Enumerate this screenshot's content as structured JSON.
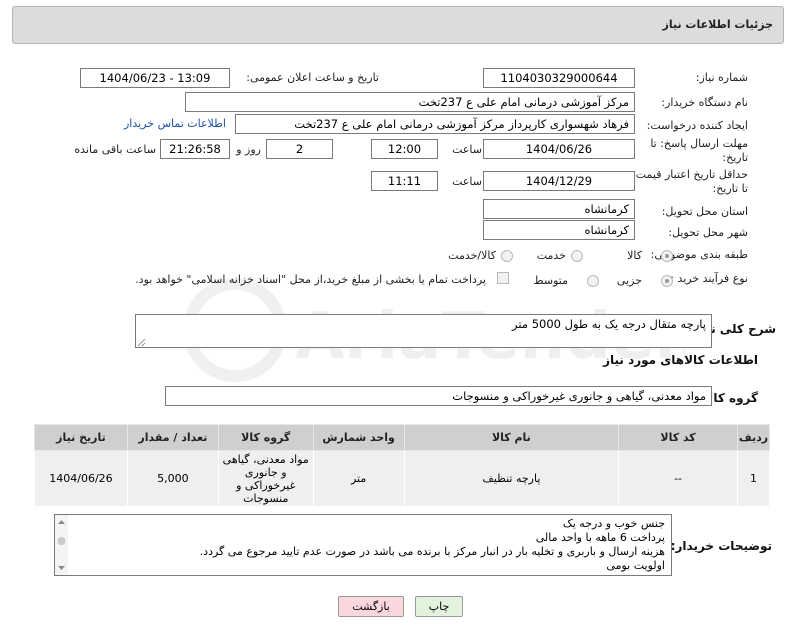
{
  "header": {
    "title": "جزئیات اطلاعات نیاز"
  },
  "form": {
    "need_number": {
      "label": "شماره نیاز:",
      "value": "1104030329000644"
    },
    "announce_datetime": {
      "label": "تاریخ و ساعت اعلان عمومی:",
      "value": "1404/06/23 - 13:09"
    },
    "buyer_org": {
      "label": "نام دستگاه خریدار:",
      "value": "مرکز آموزشی درمانی امام علی ع 237تخت"
    },
    "requester": {
      "label": "ایجاد کننده درخواست:",
      "value": "فرهاد شهسواری کارپرداز  مرکز آموزشی درمانی امام علی ع 237تخت",
      "contact_link": "اطلاعات تماس خریدار"
    },
    "reply_deadline": {
      "label_line1": "مهلت ارسال پاسخ: تا",
      "label_line2": "تاریخ:",
      "date": "1404/06/26",
      "time_label": "ساعت",
      "time": "12:00",
      "days": "2",
      "days_label": "روز و",
      "remaining_time": "21:26:58",
      "remaining_label": "ساعت باقی مانده"
    },
    "price_validity": {
      "label_line1": "حداقل تاریخ اعتبار قیمت:",
      "label_line2": "تا تاریخ:",
      "date": "1404/12/29",
      "time_label": "ساعت",
      "time": "11:11"
    },
    "delivery_province": {
      "label": "استان محل تحویل:",
      "value": "کرمانشاه"
    },
    "delivery_city": {
      "label": "شهر محل تحویل:",
      "value": "کرمانشاه"
    },
    "category": {
      "label": "طبقه بندی موضوعی:",
      "options": [
        "کالا",
        "خدمت",
        "کالا/خدمت"
      ],
      "selected": "کالا"
    },
    "purchase_type": {
      "label": "نوع فرآیند خرید :",
      "options": [
        "جزیی",
        "متوسط"
      ],
      "selected": "جزیی",
      "payment_note": "پرداخت تمام یا بخشی از مبلغ خرید،از محل \"اسناد خزانه اسلامی\" خواهد بود."
    }
  },
  "description": {
    "label": "شرح کلی نیاز:",
    "value": "پارچه متقال درجه یک به طول 5000 متر"
  },
  "goods_section": {
    "title": "اطلاعات کالاهای مورد نیاز",
    "group_label": "گروه کالا:",
    "group_value": "مواد معدنی، گیاهی و جانوری غیرخوراکی و منسوجات"
  },
  "items_table": {
    "headers": [
      "ردیف",
      "کد کالا",
      "نام کالا",
      "واحد شمارش",
      "گروه کالا",
      "تعداد / مقدار",
      "تاریخ نیاز"
    ],
    "rows": [
      {
        "row": "1",
        "code": "--",
        "name": "پارچه تنظیف",
        "unit": "متر",
        "group": "مواد معدنی، گیاهی و جانوری غیرخوراکی و منسوجات",
        "qty": "5,000",
        "date": "1404/06/26"
      }
    ]
  },
  "buyer_notes": {
    "label": "توضیحات خریدار:",
    "lines": [
      "جنس خوب و درجه یک",
      "پرداخت 6 ماهه  با واحد مالی",
      "هزینه ارسال و باربری و تخلیه بار در انبار مرکز با برنده می باشد در صورت عدم تایید مرجوع می گردد.",
      "اولویت بومی"
    ]
  },
  "buttons": {
    "print": "چاپ",
    "back": "بازگشت"
  },
  "watermark": {
    "text": "AriaTender.neT"
  },
  "colors": {
    "header_bg": "#dcdcdc",
    "table_header_bg": "#cfcfcf",
    "table_row_bg": "#efefef",
    "link": "#1a4fa8",
    "back_button_bg": "#f9d7dc",
    "print_button_bg": "#e2f2dc"
  }
}
